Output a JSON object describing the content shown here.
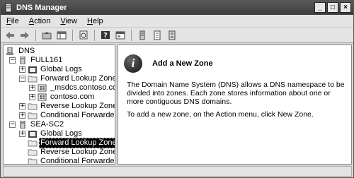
{
  "window": {
    "title": "DNS Manager"
  },
  "menu": [
    {
      "label": "File",
      "u": "F",
      "rest": "ile"
    },
    {
      "label": "Action",
      "u": "A",
      "rest": "ction"
    },
    {
      "label": "View",
      "u": "V",
      "rest": "iew"
    },
    {
      "label": "Help",
      "u": "H",
      "rest": "elp"
    }
  ],
  "toolbar": {
    "buttons": [
      "back-icon",
      "forward-icon",
      "up-folder-icon",
      "show-hide-tree-icon",
      "refresh-icon",
      "help-icon",
      "properties-icon",
      "server-icon",
      "document-icon",
      "list-icon"
    ]
  },
  "tree": {
    "root": "DNS",
    "nodes": [
      {
        "label": "FULL161",
        "icon": "server-icon",
        "expander": "−"
      },
      {
        "label": "Global Logs",
        "icon": "log-folder-icon",
        "expander": "+"
      },
      {
        "label": "Forward Lookup Zones",
        "icon": "folder-icon",
        "expander": "−"
      },
      {
        "label": "_msdcs.contoso.com",
        "icon": "zone-icon",
        "expander": "+"
      },
      {
        "label": "contoso.com",
        "icon": "zone-icon",
        "expander": "+"
      },
      {
        "label": "Reverse Lookup Zones",
        "icon": "folder-icon",
        "expander": "+"
      },
      {
        "label": "Conditional Forwarders",
        "icon": "folder-icon",
        "expander": "+"
      },
      {
        "label": "SEA-SC2",
        "icon": "server-icon",
        "expander": "−"
      },
      {
        "label": "Global Logs",
        "icon": "log-folder-icon",
        "expander": "+"
      },
      {
        "label": "Forward Lookup Zones",
        "icon": "folder-icon",
        "expander": ""
      },
      {
        "label": "Reverse Lookup Zones",
        "icon": "folder-icon",
        "expander": ""
      },
      {
        "label": "Conditional Forwarders",
        "icon": "folder-icon",
        "expander": ""
      }
    ]
  },
  "content": {
    "heading": "Add a New Zone",
    "paragraph1": "The Domain Name System (DNS) allows a DNS namespace to be divided into zones. Each zone stores information about one or more contiguous DNS domains.",
    "paragraph2": "To add a new zone, on the Action menu, click New Zone."
  }
}
